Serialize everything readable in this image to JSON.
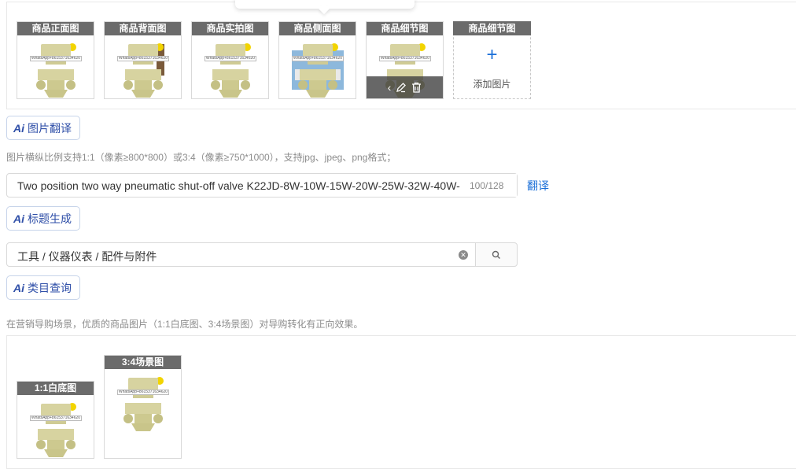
{
  "colors": {
    "accent": "#1a6fd8",
    "ai_button_text": "#2f4fa8",
    "caption_bg": "#6b6b6b",
    "product_body": "#d7d3a0",
    "product_yellow": "#f2d400"
  },
  "images": {
    "items": [
      {
        "caption": "商品正面图",
        "watermark": "WhatsApp+8615371634620"
      },
      {
        "caption": "商品背面图",
        "watermark": "WhatsApp+8615371634620"
      },
      {
        "caption": "商品实拍图",
        "watermark": "WhatsApp+8615371634620"
      },
      {
        "caption": "商品侧面图",
        "watermark": "WhatsApp+8615371634620"
      },
      {
        "caption": "商品细节图",
        "watermark": "WhatsApp+8615371634620"
      }
    ],
    "add_slot": {
      "caption": "商品细节图",
      "plus": "+",
      "label": "添加图片"
    },
    "hover_icons": [
      "chevron-left-icon",
      "edit-icon",
      "trash-icon"
    ]
  },
  "image_translate": {
    "label": "图片翻译"
  },
  "image_hint": "图片横纵比例支持1:1（像素≥800*800）或3:4（像素≥750*1000），支持jpg、jpeg、png格式；",
  "title": {
    "value": "Two position two way pneumatic shut-off valve K22JD-8W-10W-15W-20W-25W-32W-40W-",
    "counter": "100/128",
    "translate_label": "翻译"
  },
  "title_generate": {
    "label": "标题生成"
  },
  "category": {
    "value": "工具 / 仪器仪表 / 配件与附件"
  },
  "category_query": {
    "label": "类目查询"
  },
  "marketing_hint": "在营销导购场景，优质的商品图片（1:1白底图、3:4场景图）对导购转化有正向效果。",
  "marketing_images": {
    "items": [
      {
        "caption": "1:1白底图",
        "watermark": "WhatsApp+8615371634620"
      },
      {
        "caption": "3:4场景图",
        "watermark": "WhatsApp+8615371634620"
      }
    ]
  },
  "ai_icon_text": "Ai"
}
